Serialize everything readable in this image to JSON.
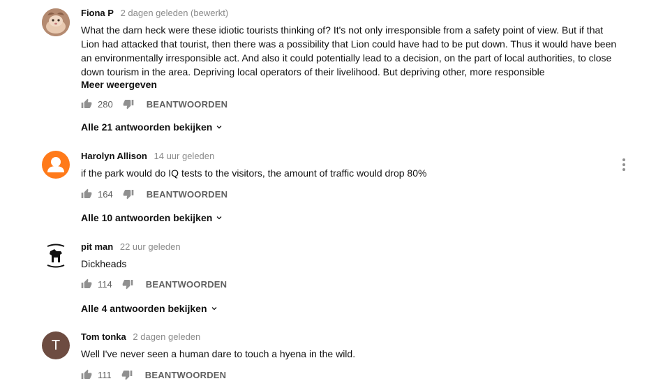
{
  "comments": [
    {
      "author": "Fiona P",
      "time": "2 dagen geleden (bewerkt)",
      "text": "What the darn heck were these  idiotic tourists thinking of? It's not only irresponsible from a safety point of view. But if that Lion had attacked that tourist, then there was a possibility that Lion could have had to be put down. Thus it would have been an environmentally irresponsible act. And also it could potentially lead to a decision, on the part of local authorities, to close down tourism in the area. Depriving local operators of their livelihood. But depriving other, more responsible",
      "more_label": "Meer weergeven",
      "likes": "280",
      "reply_label": "BEANTWOORDEN",
      "replies_label": "Alle 21 antwoorden bekijken",
      "avatar_color": "#a07860"
    },
    {
      "author": "Harolyn Allison",
      "time": "14 uur geleden",
      "text": "if the park would do IQ tests to the visitors, the amount of traffic would drop 80%",
      "likes": "164",
      "reply_label": "BEANTWOORDEN",
      "replies_label": "Alle 10 antwoorden bekijken",
      "avatar_color": "#ff7a1a"
    },
    {
      "author": "pit man",
      "time": "22 uur geleden",
      "text": "Dickheads",
      "likes": "114",
      "reply_label": "BEANTWOORDEN",
      "replies_label": "Alle 4 antwoorden bekijken",
      "avatar_color": "#ffffff"
    },
    {
      "author": "Tom tonka",
      "time": "2 dagen geleden",
      "text": "Well I've never seen a human dare to touch a hyena in the wild.",
      "likes": "111",
      "reply_label": "BEANTWOORDEN",
      "avatar_initial": "T",
      "avatar_color": "#6d4c41"
    }
  ],
  "icons": {
    "like": "thumb-up-icon",
    "dislike": "thumb-down-icon",
    "expand": "chevron-down-icon",
    "menu": "more-vert-icon"
  },
  "colors": {
    "secondary_text": "#606060",
    "timestamp": "#8a8a8a"
  }
}
